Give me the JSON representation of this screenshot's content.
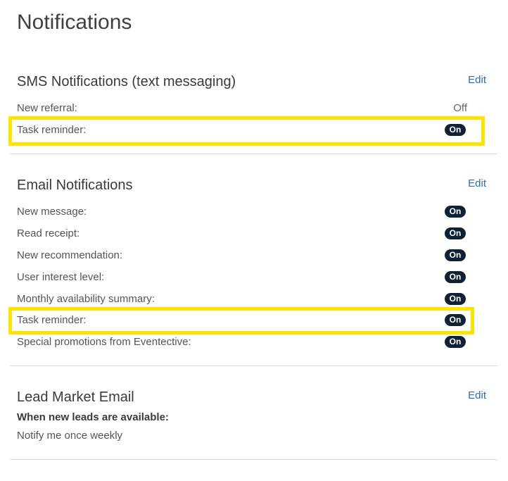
{
  "page": {
    "title": "Notifications"
  },
  "sms": {
    "title": "SMS Notifications (text messaging)",
    "edit": "Edit",
    "rows": [
      {
        "label": "New referral:",
        "value": "Off"
      },
      {
        "label": "Task reminder:",
        "value": "On"
      }
    ]
  },
  "email": {
    "title": "Email Notifications",
    "edit": "Edit",
    "rows": [
      {
        "label": "New message:",
        "value": "On"
      },
      {
        "label": "Read receipt:",
        "value": "On"
      },
      {
        "label": "New recommendation:",
        "value": "On"
      },
      {
        "label": "User interest level:",
        "value": "On"
      },
      {
        "label": "Monthly availability summary:",
        "value": "On"
      },
      {
        "label": "Task reminder:",
        "value": "On"
      },
      {
        "label": "Special promotions from Eventective:",
        "value": "On"
      }
    ]
  },
  "lead_market": {
    "title": "Lead Market Email",
    "edit": "Edit",
    "subheading": "When new leads are available:",
    "value": "Notify me once weekly"
  },
  "colors": {
    "highlight": "#fbe500",
    "pill_bg": "#0f2233",
    "link": "#2e6da4"
  }
}
